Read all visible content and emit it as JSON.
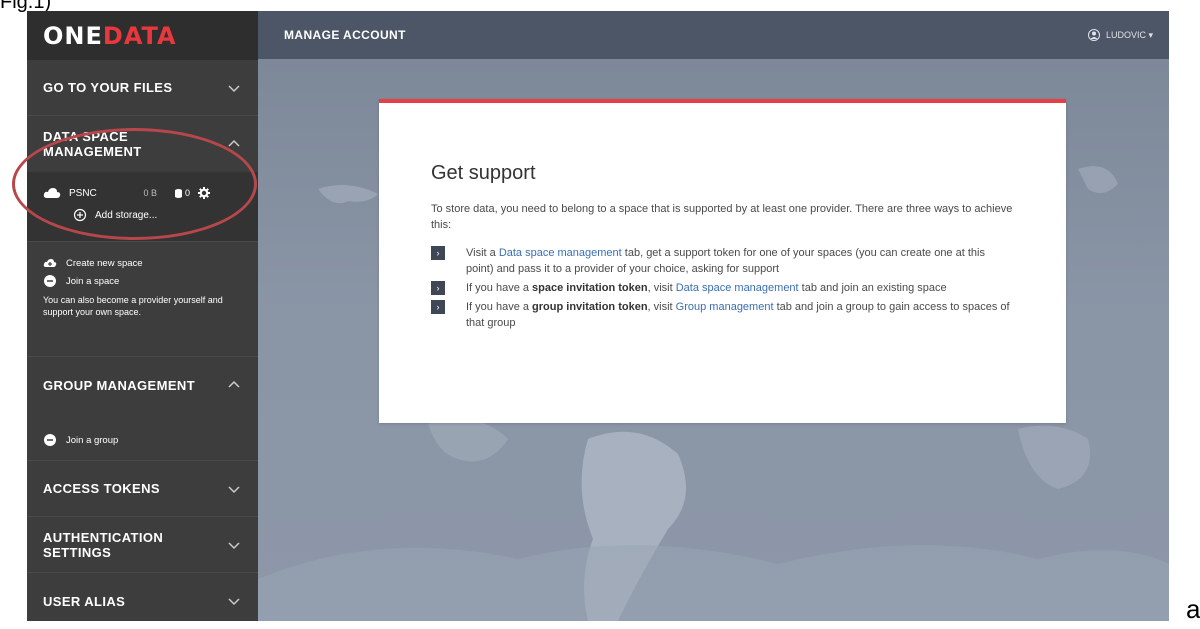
{
  "figure_label": "Fig.1)",
  "corner_letter": "a",
  "logo": {
    "part1": "ONE",
    "part2": "DATA"
  },
  "topbar": {
    "title": "MANAGE ACCOUNT",
    "user": "LUDOVIC ▾"
  },
  "sidebar": {
    "sections": [
      {
        "label": "GO TO YOUR FILES",
        "expanded": false
      },
      {
        "label": "DATA SPACE MANAGEMENT",
        "expanded": true
      },
      {
        "label": "GROUP MANAGEMENT",
        "expanded": true
      },
      {
        "label": "ACCESS TOKENS",
        "expanded": false
      },
      {
        "label": "AUTHENTICATION SETTINGS",
        "expanded": false
      },
      {
        "label": "USER ALIAS",
        "expanded": false
      }
    ],
    "space": {
      "name": "PSNC",
      "size": "0 B",
      "providers": "0",
      "add_storage": "Add storage..."
    },
    "space_actions": {
      "create": "Create new space",
      "join": "Join a space",
      "hint": "You can also become a provider yourself and support your own space."
    },
    "group_actions": {
      "join": "Join a group"
    }
  },
  "card": {
    "title": "Get support",
    "intro": "To store data, you need to belong to a space that is supported by at least one provider. There are three ways to achieve this:",
    "ways": [
      {
        "pre": "Visit a ",
        "link": "Data space management",
        "post": " tab, get a support token for one of your spaces (you can create one at this point) and pass it to a provider of your choice, asking for support"
      },
      {
        "pre": "If you have a ",
        "bold": "space invitation token",
        "mid": ", visit ",
        "link": "Data space management",
        "post": " tab and join an existing space"
      },
      {
        "pre": "If you have a ",
        "bold": "group invitation token",
        "mid": ", visit ",
        "link": "Group management",
        "post": " tab and join a group to gain access to spaces of that group"
      }
    ]
  },
  "colors": {
    "accent": "#e44046",
    "sidebar_bg": "#3d3d3d",
    "topbar_bg": "#4c5666",
    "link": "#3a6fb0"
  }
}
